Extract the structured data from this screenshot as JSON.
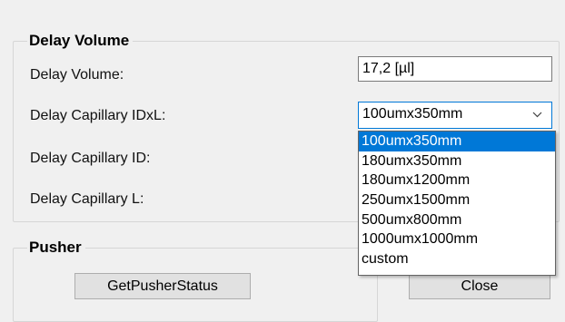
{
  "delay_volume_group": {
    "title": "Delay Volume",
    "fields": {
      "volume": {
        "label": "Delay Volume:",
        "value": "17,2 [µl]"
      },
      "capillary_idxl": {
        "label": "Delay Capillary IDxL:",
        "value": "100umx350mm"
      },
      "capillary_id": {
        "label": "Delay Capillary ID:"
      },
      "capillary_l": {
        "label": "Delay Capillary L:"
      }
    }
  },
  "dropdown": {
    "options": [
      "100umx350mm",
      "180umx350mm",
      "180umx1200mm",
      "250umx1500mm",
      "500umx800mm",
      "1000umx1000mm",
      "custom"
    ],
    "selected_index": 0
  },
  "pusher_group": {
    "title": "Pusher",
    "get_status_button": "GetPusherStatus"
  },
  "close_button": "Close",
  "icons": {
    "combo_arrow": "chevron-down-icon"
  },
  "colors": {
    "selection": "#0078d7",
    "background": "#f0f0f0"
  }
}
